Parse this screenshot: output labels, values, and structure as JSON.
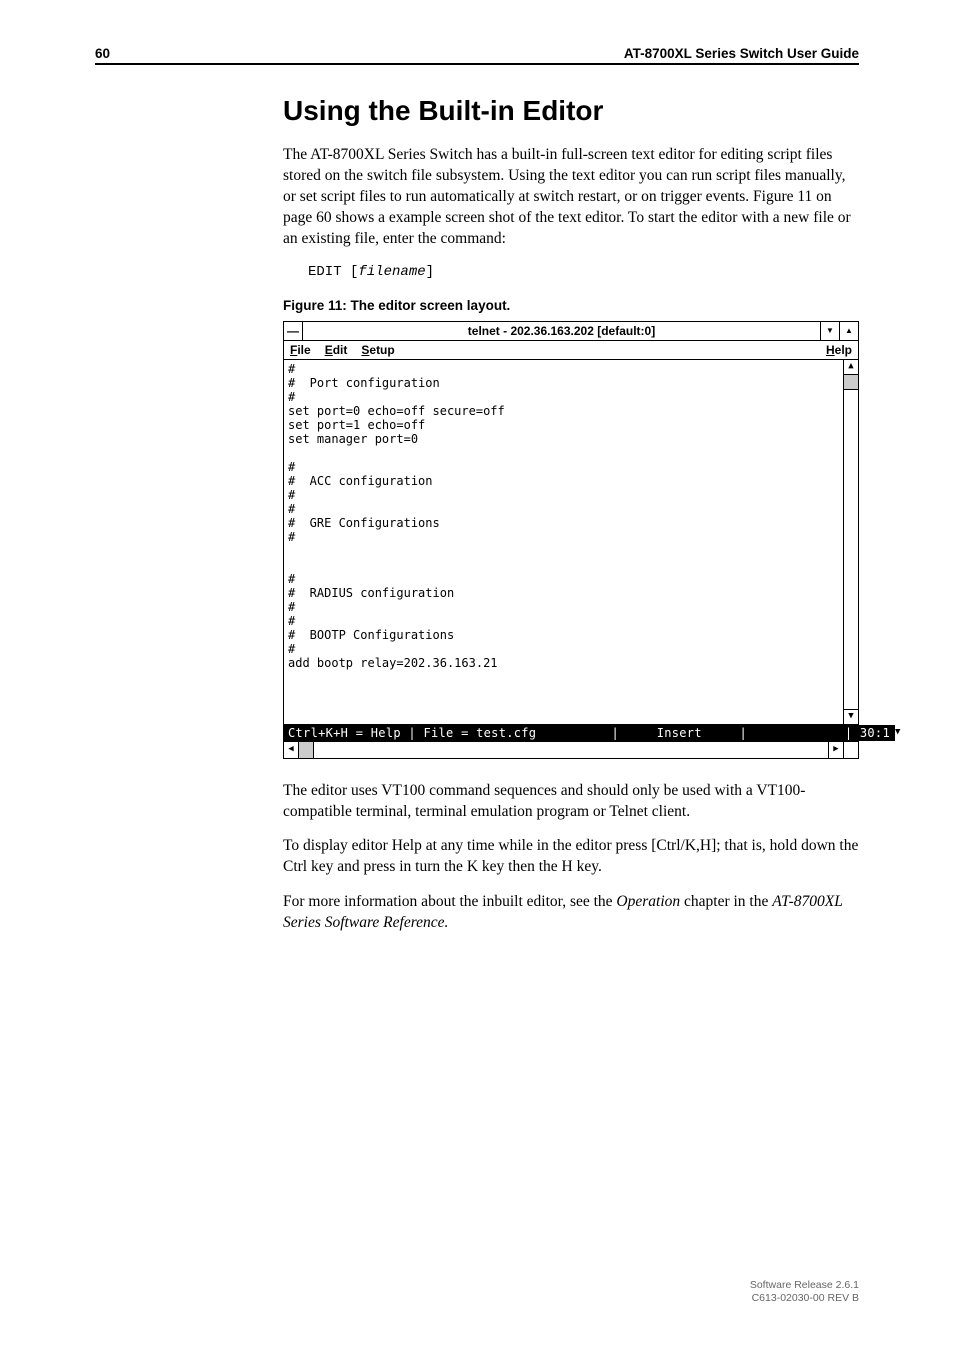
{
  "header": {
    "page_number": "60",
    "doc_title": "AT-8700XL Series Switch User Guide"
  },
  "section": {
    "title": "Using the Built-in Editor",
    "intro": "The AT-8700XL Series Switch has a built-in full-screen text editor for editing script files stored on the switch file subsystem. Using the text editor you can run script files manually, or set script files to run automatically at switch restart, or on trigger events. Figure 11 on page 60 shows a example screen shot of the text editor. To start the editor with a new file or an existing file, enter the command:",
    "command_kw": "EDIT [",
    "command_arg": "filename",
    "command_end": "]",
    "figure_caption": "Figure 11: The editor screen layout.",
    "after1": "The editor uses VT100 command sequences and should only be used with a VT100-compatible terminal, terminal emulation program or Telnet client.",
    "after2": "To display editor Help at any time while in the editor press [Ctrl/K,H]; that is, hold down the Ctrl key and press in turn the K key then the H key.",
    "after3_pre": "For more information about the inbuilt editor, see the ",
    "after3_it1": "Operation",
    "after3_mid": " chapter in the ",
    "after3_it2": "AT-8700XL Series Software Reference.",
    "after3_post": ""
  },
  "screenshot": {
    "title": "telnet - 202.36.163.202 [default:0]",
    "sys_box": "—",
    "btn_min": "▼",
    "btn_max": "▲",
    "menu_file_u": "F",
    "menu_file_r": "ile",
    "menu_edit_u": "E",
    "menu_edit_r": "dit",
    "menu_setup_u": "S",
    "menu_setup_r": "etup",
    "menu_help_u": "H",
    "menu_help_r": "elp",
    "body": "#\n#  Port configuration\n#\nset port=0 echo=off secure=off\nset port=1 echo=off\nset manager port=0\n\n#\n#  ACC configuration\n#\n#\n#  GRE Configurations\n#\n\n\n#\n#  RADIUS configuration\n#\n#\n#  BOOTP Configurations\n#\nadd bootp relay=202.36.163.21\n",
    "status": "Ctrl+K+H = Help | File = test.cfg          |     Insert     |             | 30:1",
    "arrow_up": "▲",
    "arrow_down": "▼",
    "arrow_left": "◀",
    "arrow_right": "▶"
  },
  "footer": {
    "line1": "Software Release 2.6.1",
    "line2": "C613-02030-00 REV B"
  }
}
